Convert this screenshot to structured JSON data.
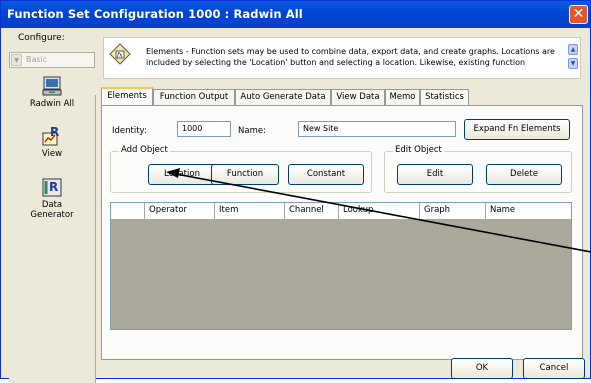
{
  "window": {
    "title": "Function Set Configuration 1000 : Radwin All",
    "close_glyph": "✕"
  },
  "sidebar": {
    "configure_label": "Configure:",
    "mode_value": "Basic",
    "items": [
      {
        "label": "Radwin All",
        "icon": "radwin-all-icon"
      },
      {
        "label": "View",
        "icon": "view-chart-icon"
      },
      {
        "label": "Data Generator",
        "label_line1": "Data",
        "label_line2": "Generator",
        "icon": "data-generator-icon"
      }
    ]
  },
  "info": {
    "text": "Elements - Function sets may be used to combine data, export data, and create graphs. Locations are included by selecting the 'Location' button and selecting a location. Likewise, existing function",
    "icon": "function-elements-icon"
  },
  "tabs": [
    {
      "label": "Elements",
      "active": true
    },
    {
      "label": "Function Output"
    },
    {
      "label": "Auto Generate Data"
    },
    {
      "label": "View Data"
    },
    {
      "label": "Memo"
    },
    {
      "label": "Statistics"
    }
  ],
  "form": {
    "identity_label": "Identity:",
    "identity_value": "1000",
    "name_label": "Name:",
    "name_value": "New Site",
    "expand_button": "Expand Fn Elements"
  },
  "add_object": {
    "label": "Add Object",
    "location_button": "Location",
    "function_button": "Function",
    "constant_button": "Constant"
  },
  "edit_object": {
    "label": "Edit Object",
    "edit_button": "Edit",
    "delete_button": "Delete"
  },
  "grid": {
    "columns": [
      "",
      "Operator",
      "Item",
      "Channel",
      "Lookup",
      "Graph",
      "Name"
    ],
    "rows": []
  },
  "footer": {
    "ok_button": "OK",
    "cancel_button": "Cancel"
  },
  "colors": {
    "title_bar": "#0046d5",
    "close_button": "#e0562f",
    "window_bg": "#ece9d8",
    "grid_bg": "#aba99c",
    "annotation_arrow": "#000000"
  }
}
